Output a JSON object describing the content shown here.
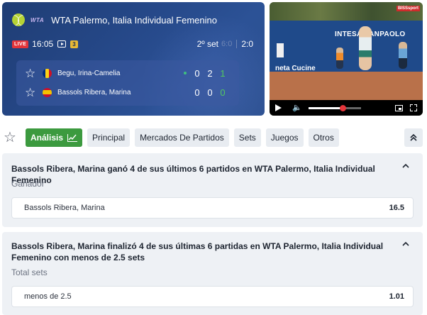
{
  "scoreboard": {
    "title": "WTA Palermo, Italia Individual Femenino",
    "tour_logo": "WTA",
    "live_label": "LIVE",
    "time": "16:05",
    "badge_count": "3",
    "set_label": "2º set",
    "prev_set": "6:0",
    "current_set": "2:0",
    "players": [
      {
        "name": "Begu, Irina-Camelia",
        "flag": "romania-flag",
        "serving": true,
        "sets": "0",
        "games": "2",
        "points": "1"
      },
      {
        "name": "Bassols Ribera, Marina",
        "flag": "spain-flag",
        "serving": false,
        "sets": "0",
        "games": "0",
        "points": "0"
      }
    ]
  },
  "video": {
    "sponsor_top": "INTESA SANPAOLO",
    "sponsor_side": "neta Cucine",
    "logo": "BISSsport",
    "progress": 0.65
  },
  "tabs": {
    "items": [
      {
        "label": "Análisis",
        "active": true
      },
      {
        "label": "Principal",
        "active": false
      },
      {
        "label": "Mercados De Partidos",
        "active": false
      },
      {
        "label": "Sets",
        "active": false
      },
      {
        "label": "Juegos",
        "active": false
      },
      {
        "label": "Otros",
        "active": false
      }
    ]
  },
  "cards": [
    {
      "title": "Bassols Ribera, Marina ganó 4 de sus últimos 6 partidos en WTA Palermo, Italia Individual Femenino",
      "market": "Ganador",
      "outcome_label": "Bassols Ribera, Marina",
      "odds": "16.5"
    },
    {
      "title": "Bassols Ribera, Marina finalizó 4 de sus últimas 6 partidas en WTA Palermo, Italia Individual Femenino con menos de 2.5 sets",
      "market": "Total sets",
      "outcome_label": "menos de 2.5",
      "odds": "1.01"
    }
  ],
  "icons": {
    "sport": "tennis-ball-icon",
    "favorite": "star-icon",
    "stream": "play-icon",
    "analysis": "chart-icon",
    "collapse": "double-chevron-up-icon",
    "card_toggle": "chevron-up-icon"
  },
  "colors": {
    "scoreboard_bg": "#26498a",
    "live": "#e2343a",
    "accent_green": "#3c9a3f",
    "points_green": "#53c95f",
    "progress_knob": "#e5363b"
  }
}
